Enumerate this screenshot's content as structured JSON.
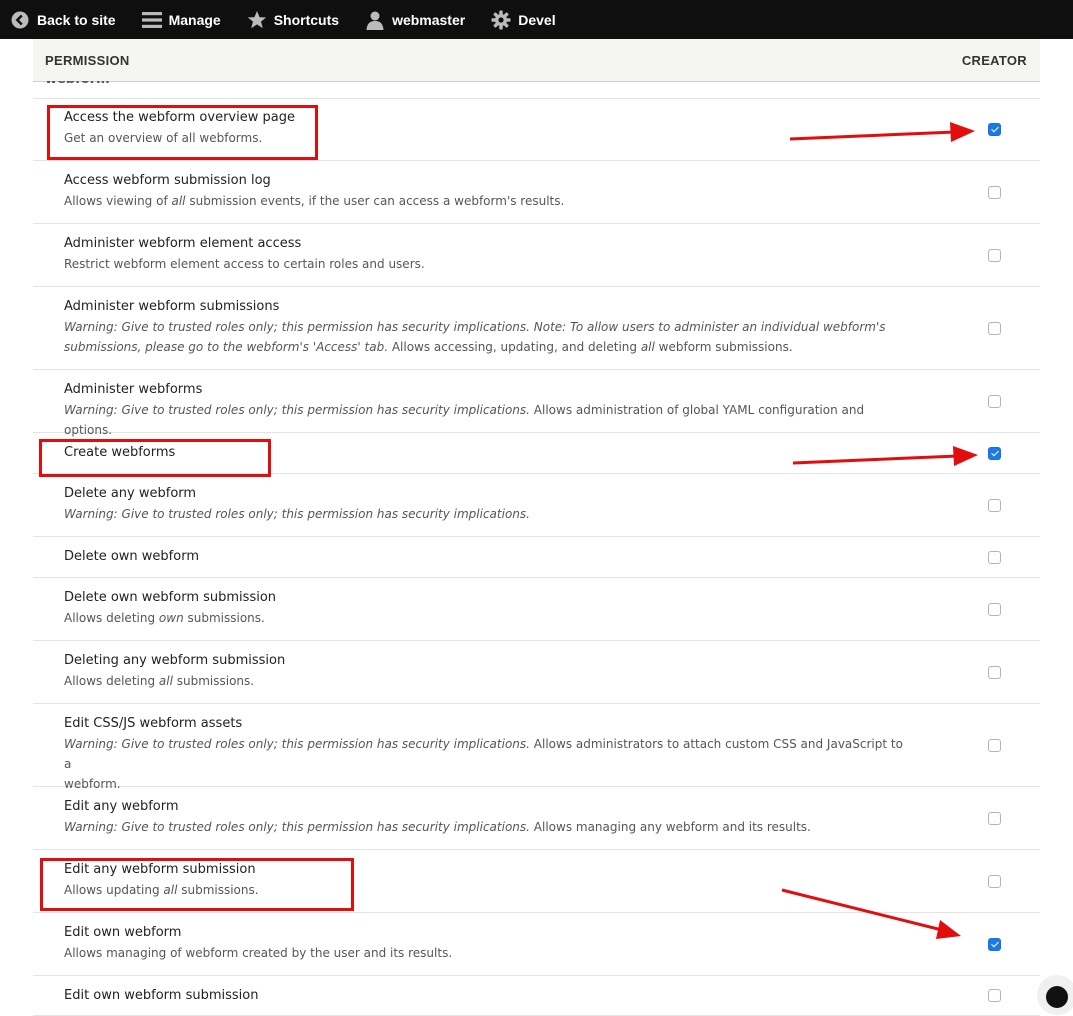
{
  "toolbar": {
    "items": [
      {
        "label": "Back to site",
        "icon": "back-arrow-icon"
      },
      {
        "label": "Manage",
        "icon": "hamburger-menu-icon"
      },
      {
        "label": "Shortcuts",
        "icon": "star-icon"
      },
      {
        "label": "webmaster",
        "icon": "user-icon"
      },
      {
        "label": "Devel",
        "icon": "gear-icon"
      }
    ]
  },
  "table": {
    "header_permission": "PERMISSION",
    "header_role": "CREATOR",
    "section_label": "webform"
  },
  "rows": [
    {
      "title": "Access the webform overview page",
      "desc": [
        "Get an overview of all webforms."
      ],
      "checked": true
    },
    {
      "title": "Access webform submission log",
      "desc": [
        "Allows viewing of |all| submission events, if the user can access a webform's results."
      ],
      "checked": false
    },
    {
      "title": "Administer webform element access",
      "desc": [
        "Restrict webform element access to certain roles and users."
      ],
      "checked": false
    },
    {
      "title": "Administer webform submissions",
      "desc": [
        "|Warning: Give to trusted roles only; this permission has security implications. Note: To allow users to administer an individual webform's|",
        "|submissions, please go to the webform's 'Access' tab.| Allows accessing, updating, and deleting |all| webform submissions."
      ],
      "checked": false
    },
    {
      "title": "Administer webforms",
      "desc": [
        "|Warning: Give to trusted roles only; this permission has security implications.| Allows administration of global YAML configuration and options."
      ],
      "checked": false
    },
    {
      "title": "Create webforms",
      "desc": [],
      "checked": true
    },
    {
      "title": "Delete any webform",
      "desc": [
        "|Warning: Give to trusted roles only; this permission has security implications.|"
      ],
      "checked": false
    },
    {
      "title": "Delete own webform",
      "desc": [],
      "checked": false
    },
    {
      "title": "Delete own webform submission",
      "desc": [
        "Allows deleting |own| submissions."
      ],
      "checked": false
    },
    {
      "title": "Deleting any webform submission",
      "desc": [
        "Allows deleting |all| submissions."
      ],
      "checked": false
    },
    {
      "title": "Edit CSS/JS webform assets",
      "desc": [
        "|Warning: Give to trusted roles only; this permission has security implications.| Allows administrators to attach custom CSS and JavaScript to a",
        "webform."
      ],
      "checked": false
    },
    {
      "title": "Edit any webform",
      "desc": [
        "|Warning: Give to trusted roles only; this permission has security implications.| Allows managing any webform and its results."
      ],
      "checked": false
    },
    {
      "title": "Edit any webform submission",
      "desc": [
        "Allows updating |all| submissions."
      ],
      "checked": false
    },
    {
      "title": "Edit own webform",
      "desc": [
        "Allows managing of webform created by the user and its results."
      ],
      "checked": true
    },
    {
      "title": "Edit own webform submission",
      "desc": [],
      "checked": false
    }
  ],
  "colors": {
    "toolbar_bg": "#0f0f0f",
    "checkbox_checked": "#1b7ae8",
    "annotation_red": "#e20d0d"
  }
}
